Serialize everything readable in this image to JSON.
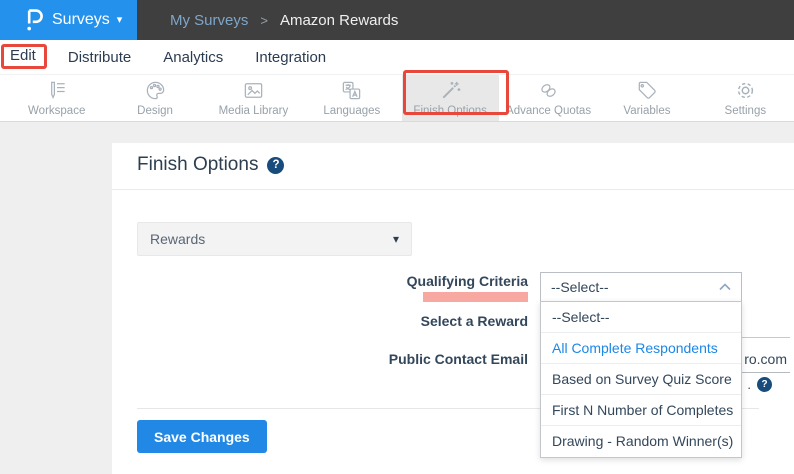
{
  "header": {
    "app_name": "Surveys",
    "breadcrumb": {
      "parent": "My Surveys",
      "separator": ">",
      "current": "Amazon Rewards"
    }
  },
  "nav": {
    "items": [
      {
        "label": "Edit",
        "active": true,
        "annotated": true
      },
      {
        "label": "Distribute"
      },
      {
        "label": "Analytics"
      },
      {
        "label": "Integration"
      }
    ]
  },
  "toolbar": {
    "items": [
      {
        "label": "Workspace",
        "icon": "workspace-icon"
      },
      {
        "label": "Design",
        "icon": "design-icon"
      },
      {
        "label": "Media Library",
        "icon": "media-library-icon"
      },
      {
        "label": "Languages",
        "icon": "languages-icon"
      },
      {
        "label": "Finish Options",
        "icon": "finish-options-icon",
        "active": true,
        "annotated": true
      },
      {
        "label": "Advance Quotas",
        "icon": "advance-quotas-icon"
      },
      {
        "label": "Variables",
        "icon": "variables-icon"
      },
      {
        "label": "Settings",
        "icon": "settings-icon"
      }
    ]
  },
  "main": {
    "title": "Finish Options",
    "survey_type_select": {
      "value": "Rewards"
    },
    "form": {
      "qualifying_criteria": {
        "label": "Qualifying Criteria",
        "selected": "--Select--",
        "options": [
          {
            "label": "--Select--"
          },
          {
            "label": "All Complete Respondents",
            "highlighted": true
          },
          {
            "label": "Based on Survey Quiz Score"
          },
          {
            "label": "First N Number of Completes"
          },
          {
            "label": "Drawing - Random Winner(s)"
          }
        ]
      },
      "select_a_reward": {
        "label": "Select a Reward"
      },
      "public_contact_email": {
        "label": "Public Contact Email",
        "visible_value": "ro.com",
        "helper_visible_text": "."
      }
    },
    "save_button_label": "Save Changes"
  },
  "colors": {
    "brand_blue": "#2492ec",
    "header_dark": "#3f3f3f",
    "accent_blue": "#1b87e6",
    "annotation_red": "#e8473b",
    "highlight_pink": "#f7a8a0",
    "help_navy": "#174c7c",
    "save_button_blue": "#2188e6"
  }
}
